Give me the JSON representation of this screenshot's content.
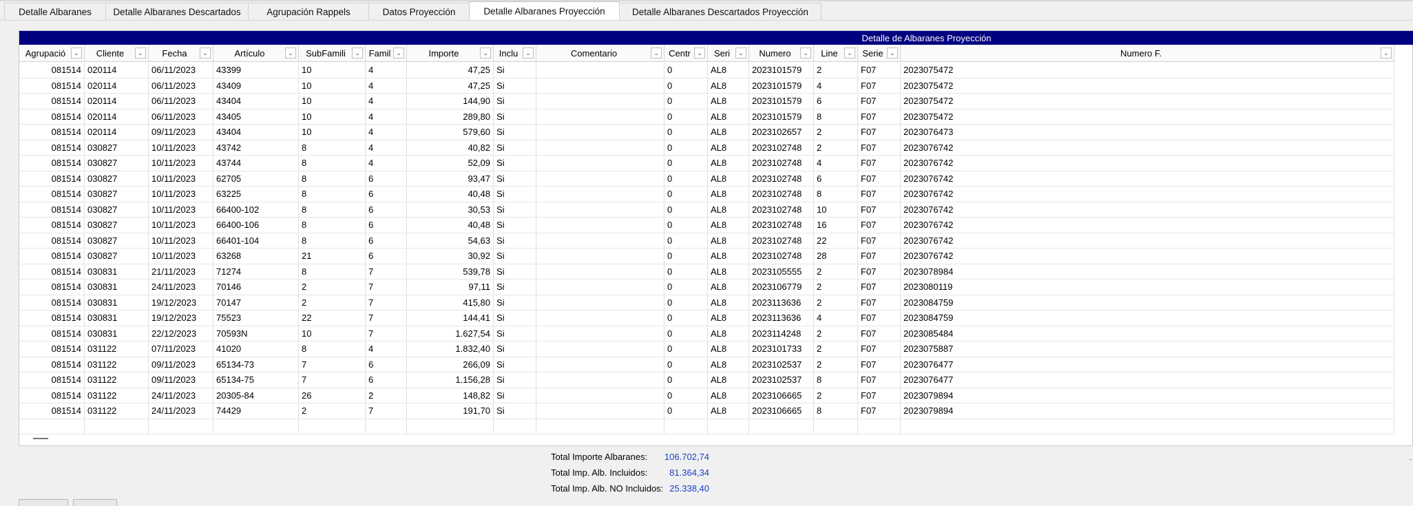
{
  "tabs": [
    {
      "label": "Detalle Albaranes",
      "active": false
    },
    {
      "label": "Detalle Albaranes Descartados",
      "active": false
    },
    {
      "label": "Agrupación Rappels",
      "active": false
    },
    {
      "label": "Datos Proyección",
      "active": false
    },
    {
      "label": "Detalle Albaranes Proyección",
      "active": true
    },
    {
      "label": "Detalle Albaranes Descartados Proyección",
      "active": false
    }
  ],
  "grid": {
    "title": "Detalle de Albaranes Proyección",
    "columns": [
      "Agrupació",
      "Cliente",
      "Fecha",
      "Artículo",
      "SubFamili",
      "Famil",
      "Importe",
      "Inclu",
      "Comentario",
      "Centr",
      "Seri",
      "Numero",
      "Line",
      "Serie",
      "Numero F."
    ],
    "rows": [
      [
        "081514",
        "020114",
        "06/11/2023",
        "43399",
        "10",
        "4",
        "47,25",
        "Si",
        "",
        "0",
        "AL8",
        "2023101579",
        "2",
        "F07",
        "2023075472"
      ],
      [
        "081514",
        "020114",
        "06/11/2023",
        "43409",
        "10",
        "4",
        "47,25",
        "Si",
        "",
        "0",
        "AL8",
        "2023101579",
        "4",
        "F07",
        "2023075472"
      ],
      [
        "081514",
        "020114",
        "06/11/2023",
        "43404",
        "10",
        "4",
        "144,90",
        "Si",
        "",
        "0",
        "AL8",
        "2023101579",
        "6",
        "F07",
        "2023075472"
      ],
      [
        "081514",
        "020114",
        "06/11/2023",
        "43405",
        "10",
        "4",
        "289,80",
        "Si",
        "",
        "0",
        "AL8",
        "2023101579",
        "8",
        "F07",
        "2023075472"
      ],
      [
        "081514",
        "020114",
        "09/11/2023",
        "43404",
        "10",
        "4",
        "579,60",
        "Si",
        "",
        "0",
        "AL8",
        "2023102657",
        "2",
        "F07",
        "2023076473"
      ],
      [
        "081514",
        "030827",
        "10/11/2023",
        "43742",
        "8",
        "4",
        "40,82",
        "Si",
        "",
        "0",
        "AL8",
        "2023102748",
        "2",
        "F07",
        "2023076742"
      ],
      [
        "081514",
        "030827",
        "10/11/2023",
        "43744",
        "8",
        "4",
        "52,09",
        "Si",
        "",
        "0",
        "AL8",
        "2023102748",
        "4",
        "F07",
        "2023076742"
      ],
      [
        "081514",
        "030827",
        "10/11/2023",
        "62705",
        "8",
        "6",
        "93,47",
        "Si",
        "",
        "0",
        "AL8",
        "2023102748",
        "6",
        "F07",
        "2023076742"
      ],
      [
        "081514",
        "030827",
        "10/11/2023",
        "63225",
        "8",
        "6",
        "40,48",
        "Si",
        "",
        "0",
        "AL8",
        "2023102748",
        "8",
        "F07",
        "2023076742"
      ],
      [
        "081514",
        "030827",
        "10/11/2023",
        "66400-102",
        "8",
        "6",
        "30,53",
        "Si",
        "",
        "0",
        "AL8",
        "2023102748",
        "10",
        "F07",
        "2023076742"
      ],
      [
        "081514",
        "030827",
        "10/11/2023",
        "66400-106",
        "8",
        "6",
        "40,48",
        "Si",
        "",
        "0",
        "AL8",
        "2023102748",
        "16",
        "F07",
        "2023076742"
      ],
      [
        "081514",
        "030827",
        "10/11/2023",
        "66401-104",
        "8",
        "6",
        "54,63",
        "Si",
        "",
        "0",
        "AL8",
        "2023102748",
        "22",
        "F07",
        "2023076742"
      ],
      [
        "081514",
        "030827",
        "10/11/2023",
        "63268",
        "21",
        "6",
        "30,92",
        "Si",
        "",
        "0",
        "AL8",
        "2023102748",
        "28",
        "F07",
        "2023076742"
      ],
      [
        "081514",
        "030831",
        "21/11/2023",
        "71274",
        "8",
        "7",
        "539,78",
        "Si",
        "",
        "0",
        "AL8",
        "2023105555",
        "2",
        "F07",
        "2023078984"
      ],
      [
        "081514",
        "030831",
        "24/11/2023",
        "70146",
        "2",
        "7",
        "97,11",
        "Si",
        "",
        "0",
        "AL8",
        "2023106779",
        "2",
        "F07",
        "2023080119"
      ],
      [
        "081514",
        "030831",
        "19/12/2023",
        "70147",
        "2",
        "7",
        "415,80",
        "Si",
        "",
        "0",
        "AL8",
        "2023113636",
        "2",
        "F07",
        "2023084759"
      ],
      [
        "081514",
        "030831",
        "19/12/2023",
        "75523",
        "22",
        "7",
        "144,41",
        "Si",
        "",
        "0",
        "AL8",
        "2023113636",
        "4",
        "F07",
        "2023084759"
      ],
      [
        "081514",
        "030831",
        "22/12/2023",
        "70593N",
        "10",
        "7",
        "1.627,54",
        "Si",
        "",
        "0",
        "AL8",
        "2023114248",
        "2",
        "F07",
        "2023085484"
      ],
      [
        "081514",
        "031122",
        "07/11/2023",
        "41020",
        "8",
        "4",
        "1.832,40",
        "Si",
        "",
        "0",
        "AL8",
        "2023101733",
        "2",
        "F07",
        "2023075887"
      ],
      [
        "081514",
        "031122",
        "09/11/2023",
        "65134-73",
        "7",
        "6",
        "266,09",
        "Si",
        "",
        "0",
        "AL8",
        "2023102537",
        "2",
        "F07",
        "2023076477"
      ],
      [
        "081514",
        "031122",
        "09/11/2023",
        "65134-75",
        "7",
        "6",
        "1.156,28",
        "Si",
        "",
        "0",
        "AL8",
        "2023102537",
        "8",
        "F07",
        "2023076477"
      ],
      [
        "081514",
        "031122",
        "24/11/2023",
        "20305-84",
        "26",
        "2",
        "148,82",
        "Si",
        "",
        "0",
        "AL8",
        "2023106665",
        "2",
        "F07",
        "2023079894"
      ],
      [
        "081514",
        "031122",
        "24/11/2023",
        "74429",
        "2",
        "7",
        "191,70",
        "Si",
        "",
        "0",
        "AL8",
        "2023106665",
        "8",
        "F07",
        "2023079894"
      ]
    ]
  },
  "totals": [
    {
      "label": "Total Importe Albaranes:",
      "value": "106.702,74"
    },
    {
      "label": "Total Imp. Alb. Incluidos:",
      "value": "81.364,34"
    },
    {
      "label": "Total Imp. Alb. NO Incluidos:",
      "value": "25.338,40"
    }
  ],
  "colors": {
    "title_bar": "#000080",
    "total_value": "#1a3fc4"
  },
  "icons": {
    "column_filter": "chevron-down-icon"
  }
}
